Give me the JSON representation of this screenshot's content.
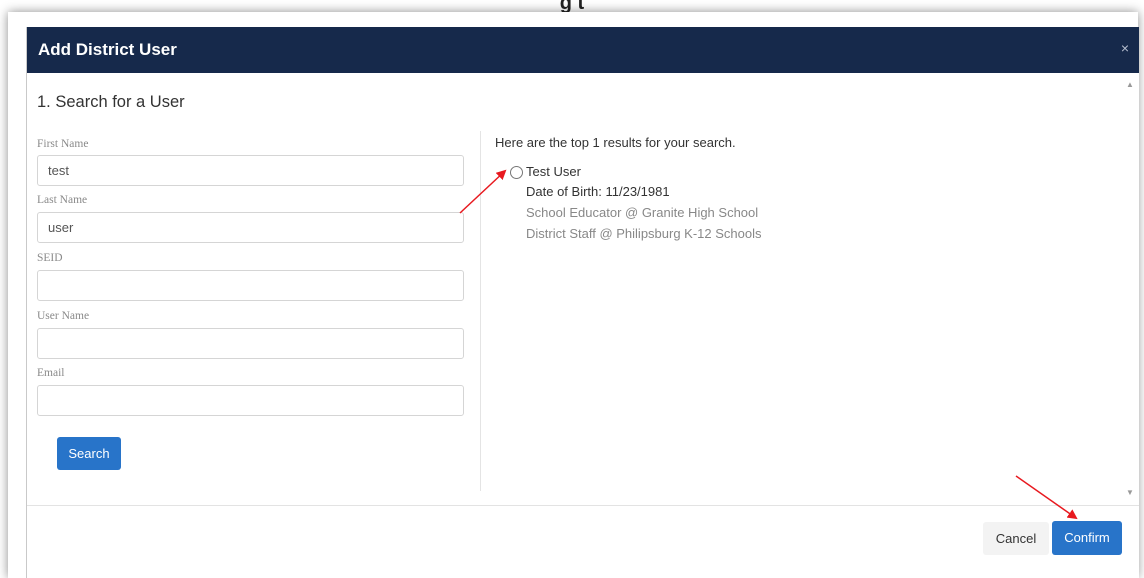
{
  "page_heading_partial": "g t",
  "modal": {
    "title": "Add District User",
    "close_glyph": "×"
  },
  "search_form": {
    "section_title": "1. Search for a User",
    "fields": [
      {
        "label": "First Name",
        "value": "test",
        "placeholder": ""
      },
      {
        "label": "Last Name",
        "value": "user",
        "placeholder": ""
      },
      {
        "label": "SEID",
        "value": "",
        "placeholder": ""
      },
      {
        "label": "User Name",
        "value": "",
        "placeholder": ""
      },
      {
        "label": "Email",
        "value": "",
        "placeholder": ""
      }
    ],
    "search_label": "Search"
  },
  "results": {
    "heading": "Here are the top 1 results for your search.",
    "items": [
      {
        "name": "Test User",
        "dob": "Date of Birth: 11/23/1981",
        "affiliations": [
          "School Educator @ Granite High School",
          "District Staff @ Philipsburg K-12 Schools"
        ]
      }
    ]
  },
  "footer": {
    "cancel_label": "Cancel",
    "confirm_label": "Confirm"
  },
  "colors": {
    "header_bg": "#16294b",
    "primary_button": "#2874c9",
    "annotation_arrow": "#e8191f"
  },
  "icons": {
    "close": "close-icon",
    "scroll_up": "scroll-up-arrow-icon",
    "scroll_down": "scroll-down-arrow-icon",
    "radio": "radio-button-icon"
  }
}
